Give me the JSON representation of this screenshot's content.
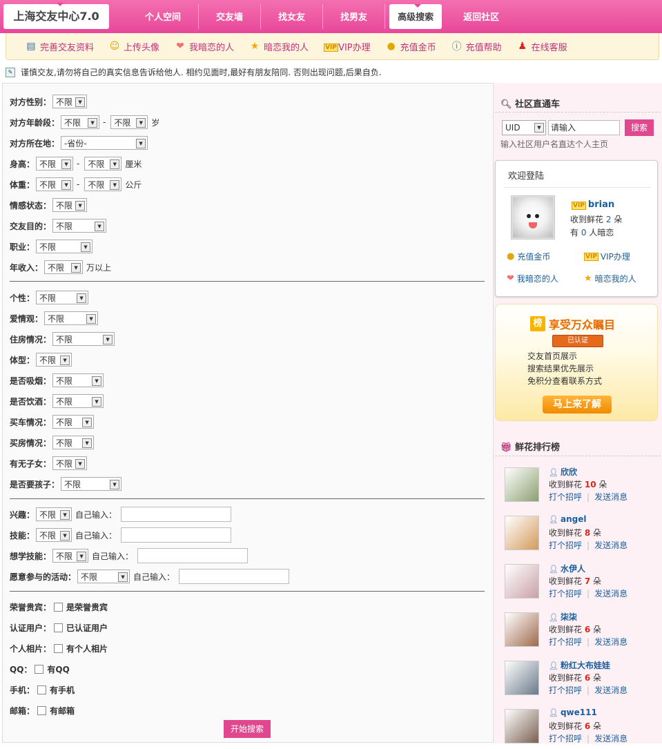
{
  "app": {
    "title": "上海交友中心7.0"
  },
  "nav": [
    "个人空间",
    "交友墙",
    "找女友",
    "找男友",
    "高级搜索",
    "返回社区"
  ],
  "nav_active": 4,
  "subnav": [
    {
      "label": "完善交友资料",
      "icon": "profile-card-icon"
    },
    {
      "label": "上传头像",
      "icon": "smiley-icon"
    },
    {
      "label": "我暗恋的人",
      "icon": "heart-icon"
    },
    {
      "label": "暗恋我的人",
      "icon": "star-icon"
    },
    {
      "label": "VIP办理",
      "icon": "vip-icon"
    },
    {
      "label": "充值金币",
      "icon": "coins-icon"
    },
    {
      "label": "充值帮助",
      "icon": "info-icon"
    },
    {
      "label": "在线客服",
      "icon": "support-icon"
    }
  ],
  "notice": "谨慎交友,请勿将自己的真实信息告诉给他人. 相约见面时,最好有朋友陪同. 否则出现问题,后果自负.",
  "form": {
    "gender": {
      "label": "对方性别：",
      "value": "不限"
    },
    "age": {
      "label": "对方年龄段：",
      "from": "不限",
      "to": "不限",
      "sep": "-",
      "unit": "岁"
    },
    "location": {
      "label": "对方所在地：",
      "value": "-省份-"
    },
    "height": {
      "label": "身高：",
      "from": "不限",
      "to": "不限",
      "sep": "-",
      "unit": "厘米"
    },
    "weight": {
      "label": "体重：",
      "from": "不限",
      "to": "不限",
      "sep": "-",
      "unit": "公斤"
    },
    "marital": {
      "label": "情感状态：",
      "value": "不限"
    },
    "purpose": {
      "label": "交友目的：",
      "value": "不限"
    },
    "job": {
      "label": "职业：",
      "value": "不限"
    },
    "income": {
      "label": "年收入：",
      "value": "不限",
      "unit": "万以上"
    },
    "personality": {
      "label": "个性：",
      "value": "不限"
    },
    "love_view": {
      "label": "爱情观：",
      "value": "不限"
    },
    "housing": {
      "label": "住房情况：",
      "value": "不限"
    },
    "body": {
      "label": "体型：",
      "value": "不限"
    },
    "smoke": {
      "label": "是否吸烟：",
      "value": "不限"
    },
    "drink": {
      "label": "是否饮酒：",
      "value": "不限"
    },
    "car": {
      "label": "买车情况：",
      "value": "不限"
    },
    "house_buy": {
      "label": "买房情况：",
      "value": "不限"
    },
    "children": {
      "label": "有无子女：",
      "value": "不限"
    },
    "want_child": {
      "label": "是否要孩子：",
      "value": "不限"
    },
    "interest": {
      "label": "兴趣：",
      "value": "不限",
      "custom": "自己输入："
    },
    "skill": {
      "label": "技能：",
      "value": "不限",
      "custom": "自己输入："
    },
    "learn": {
      "label": "想学技能：",
      "value": "不限",
      "custom": "自己输入："
    },
    "activity": {
      "label": "愿意参与的活动：",
      "value": "不限",
      "custom": "自己输入："
    },
    "honor": {
      "label": "荣誉贵宾：",
      "option": "是荣誉贵宾"
    },
    "verified": {
      "label": "认证用户：",
      "option": "已认证用户"
    },
    "photo": {
      "label": "个人相片：",
      "option": "有个人相片"
    },
    "qq": {
      "label": "QQ：",
      "option": "有QQ"
    },
    "mobile": {
      "label": "手机：",
      "option": "有手机"
    },
    "email": {
      "label": "邮箱：",
      "option": "有邮箱"
    },
    "submit": "开始搜索"
  },
  "side": {
    "direct_title": "社区直通车",
    "uid_option": "UID",
    "uid_placeholder": "请输入",
    "search_btn": "搜索",
    "hint": "输入社区用户名直达个人主页",
    "login_title": "欢迎登陆",
    "user": {
      "name": "brian",
      "flowers_pre": "收到鲜花",
      "flowers": "2",
      "flowers_post": "朵",
      "crush_pre": "有",
      "crush": "0",
      "crush_post": "人暗恋"
    },
    "links": [
      {
        "label": "充值金币",
        "icon": "coins-icon"
      },
      {
        "label": "VIP办理",
        "icon": "vip-icon"
      },
      {
        "label": "我暗恋的人",
        "icon": "heart-icon"
      },
      {
        "label": "暗恋我的人",
        "icon": "star-icon"
      }
    ],
    "promo": {
      "badge": "榜",
      "title": "享受万众瞩目",
      "cert": "已认证",
      "lines": [
        "交友首页展示",
        "搜索结果优先展示",
        "免积分查看联系方式"
      ],
      "button": "马上来了解"
    },
    "rank_title": "鲜花排行榜",
    "rank_flowers_pre": "收到鲜花",
    "rank_flowers_post": "朵",
    "rank_greet": "打个招呼",
    "rank_msg": "发送消息",
    "ranks": [
      {
        "name": "欣欣",
        "flowers": "10",
        "color": "#8aa070"
      },
      {
        "name": "angel",
        "flowers": "8",
        "color": "#d49a5c"
      },
      {
        "name": "水伊人",
        "flowers": "7",
        "color": "#c9a0a8"
      },
      {
        "name": "柒柒",
        "flowers": "6",
        "color": "#a06a4e"
      },
      {
        "name": "粉红大布娃娃",
        "flowers": "6",
        "color": "#6a7a8a"
      },
      {
        "name": "qwe111",
        "flowers": "6",
        "color": "#7a6050"
      }
    ]
  }
}
